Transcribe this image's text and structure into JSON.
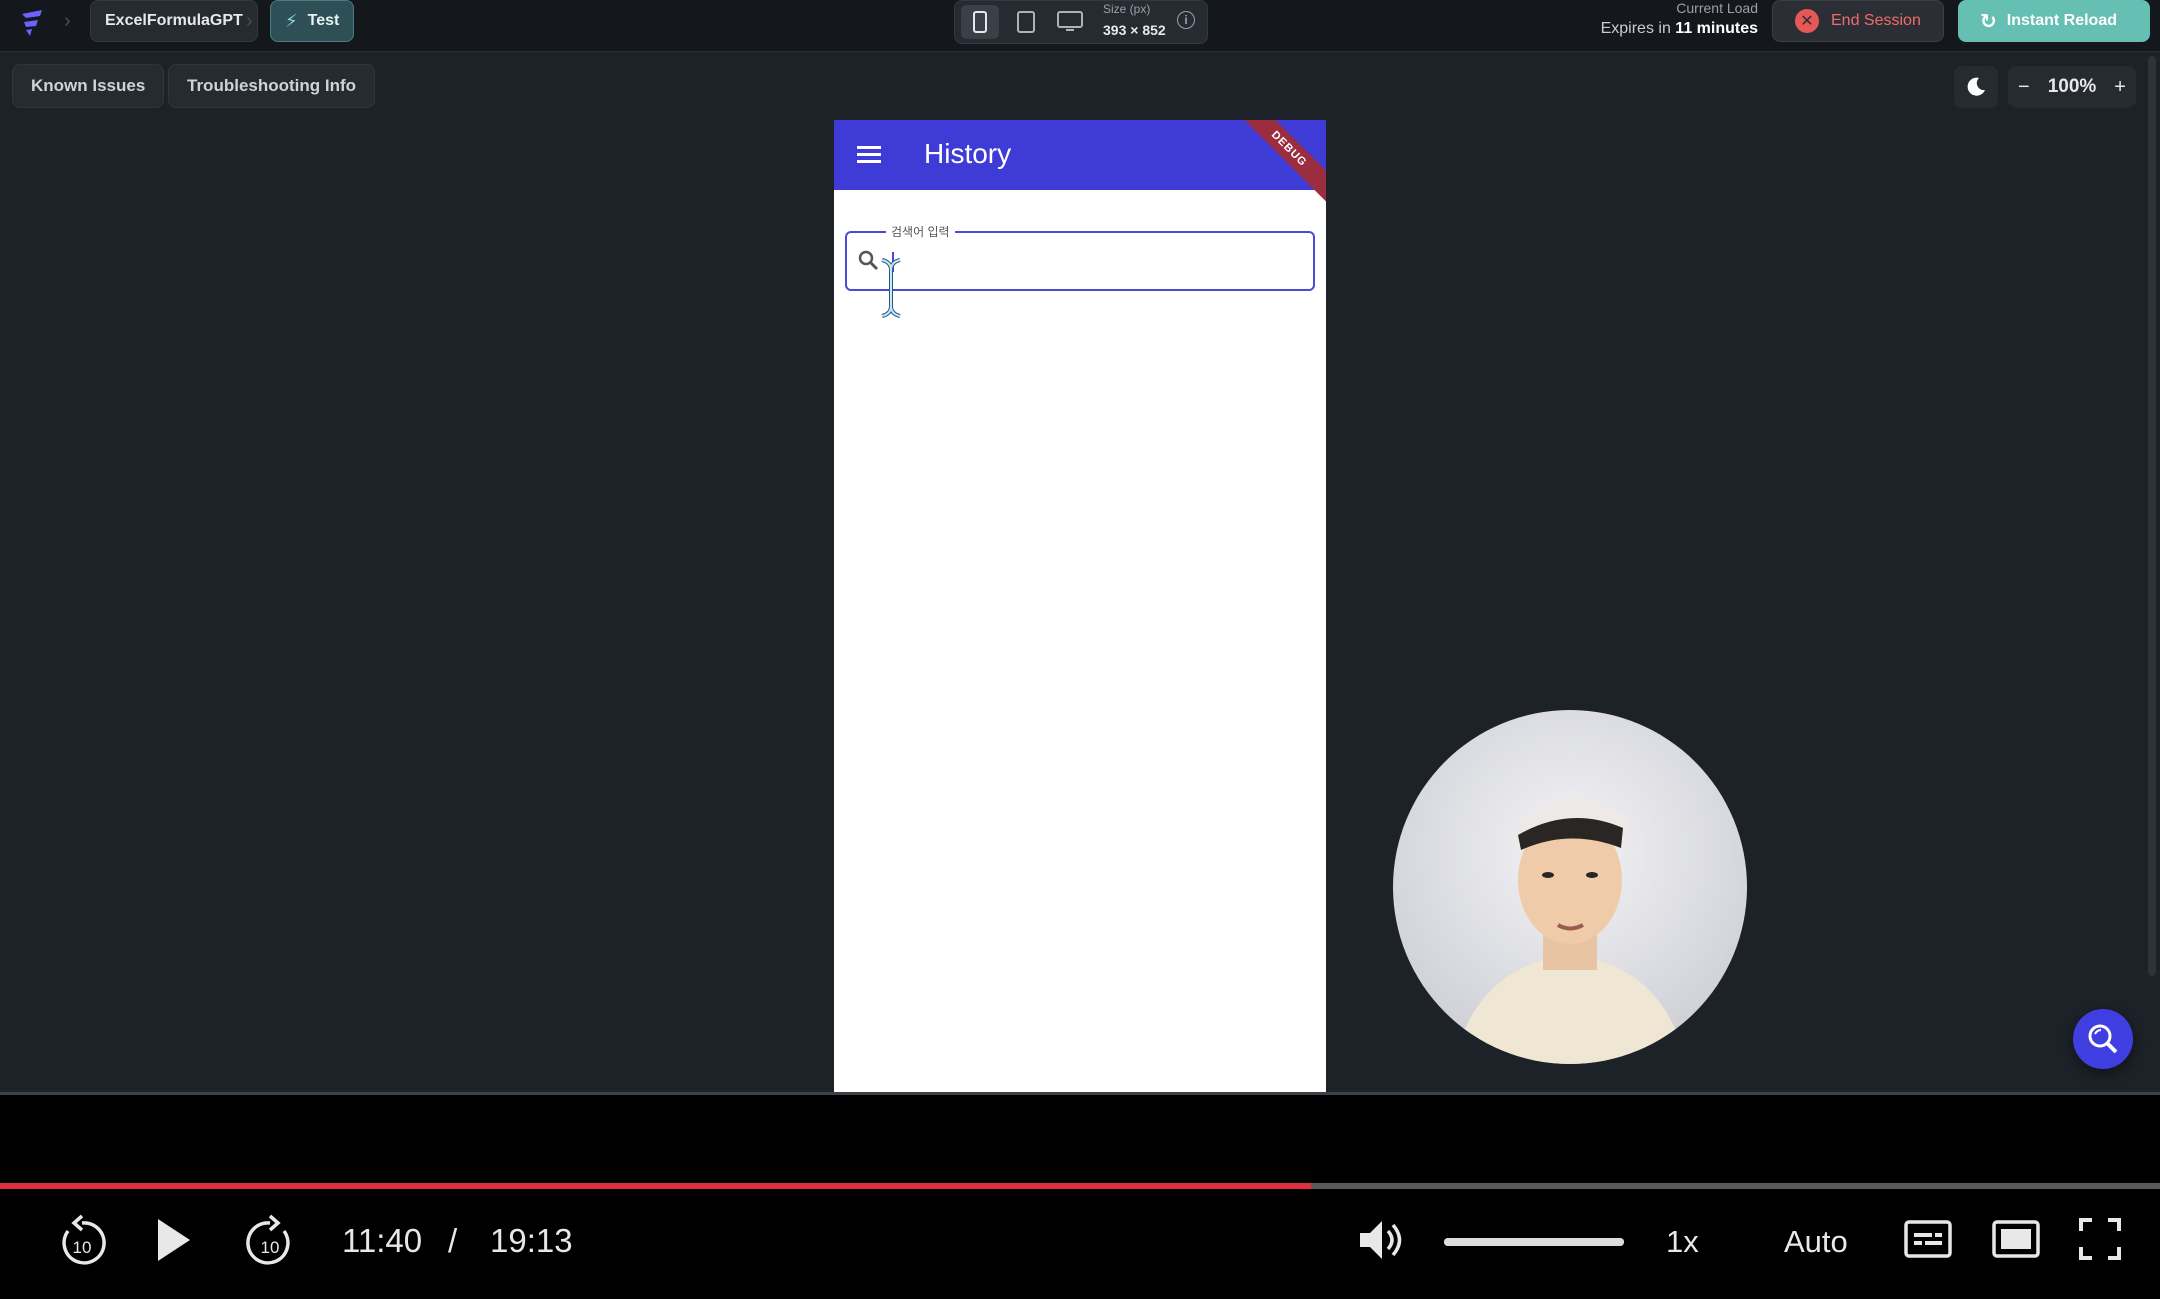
{
  "topbar": {
    "project_name": "ExcelFormulaGPT",
    "mode_label": "Test",
    "size_label": "Size (px)",
    "size_value": "393 × 852",
    "load_label": "Current Load",
    "expires_prefix": "Expires in ",
    "expires_value": "11 minutes",
    "end_session_label": "End Session",
    "instant_reload_label": "Instant Reload"
  },
  "subbar": {
    "known_issues_label": "Known Issues",
    "troubleshooting_label": "Troubleshooting Info",
    "zoom_value": "100%",
    "zoom_minus": "−",
    "zoom_plus": "+"
  },
  "app": {
    "title": "History",
    "debug_banner": "DEBUG",
    "search_label": "검색어 입력",
    "search_value": ""
  },
  "player": {
    "current_time": "11:40",
    "separator": "/",
    "total_time": "19:13",
    "progress_fraction": 0.607,
    "volume_fraction": 1.0,
    "speed_label": "1x",
    "quality_label": "Auto",
    "skip_seconds": "10"
  },
  "colors": {
    "appbar": "#3e3bd6",
    "reload_button": "#66bfb3",
    "end_session_text": "#f06b6b",
    "progress": "#e03040"
  }
}
